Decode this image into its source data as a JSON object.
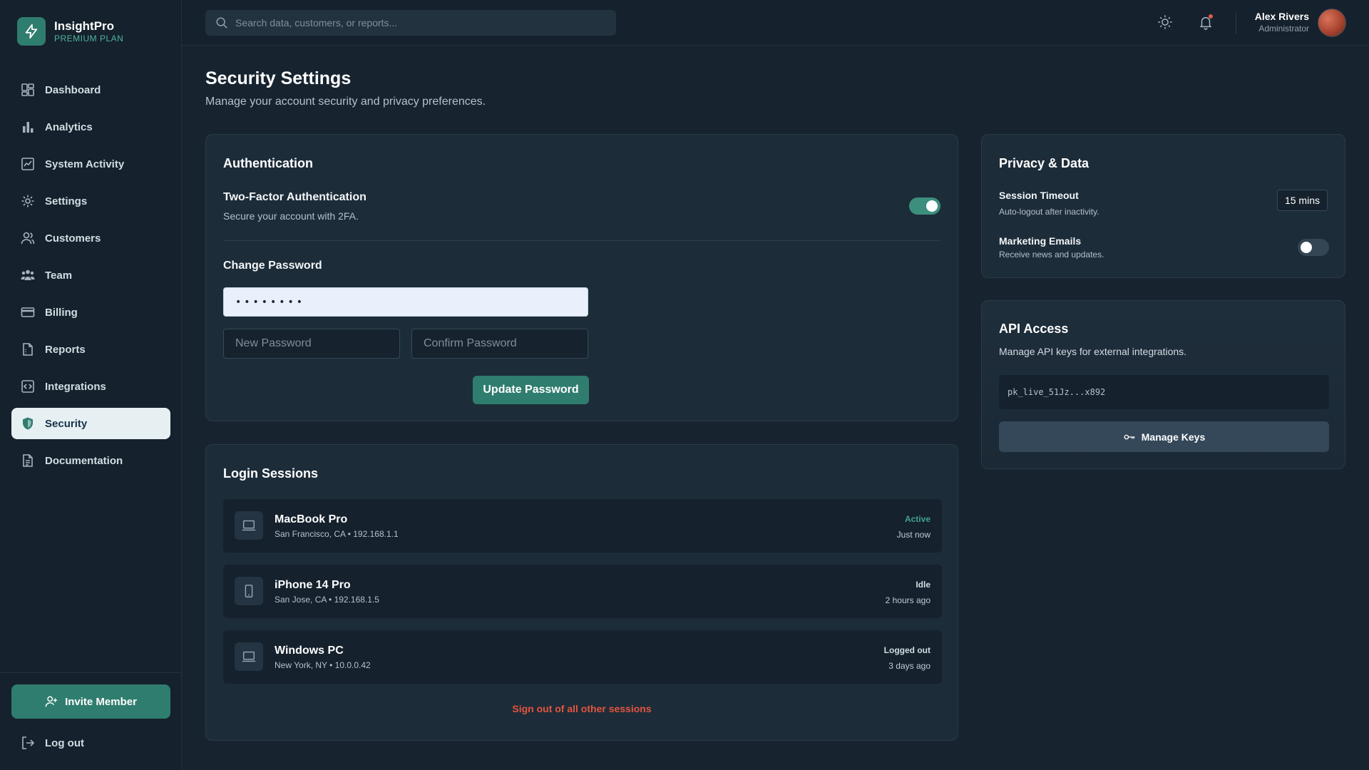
{
  "brand": {
    "name": "InsightPro",
    "plan": "PREMIUM PLAN"
  },
  "sidebar": {
    "items": [
      {
        "label": "Dashboard",
        "icon": "dashboard-icon"
      },
      {
        "label": "Analytics",
        "icon": "bar-chart-icon"
      },
      {
        "label": "System Activity",
        "icon": "activity-chart-icon"
      },
      {
        "label": "Settings",
        "icon": "gear-icon"
      },
      {
        "label": "Customers",
        "icon": "users-icon"
      },
      {
        "label": "Team",
        "icon": "team-icon"
      },
      {
        "label": "Billing",
        "icon": "credit-card-icon"
      },
      {
        "label": "Reports",
        "icon": "report-icon"
      },
      {
        "label": "Integrations",
        "icon": "integration-icon"
      },
      {
        "label": "Security",
        "icon": "shield-icon",
        "active": true
      },
      {
        "label": "Documentation",
        "icon": "document-icon"
      }
    ],
    "invite_label": "Invite Member",
    "logout_label": "Log out"
  },
  "topbar": {
    "search_placeholder": "Search data, customers, or reports...",
    "user_name": "Alex Rivers",
    "user_role": "Administrator"
  },
  "page": {
    "title": "Security Settings",
    "subtitle": "Manage your account security and privacy preferences."
  },
  "authentication": {
    "title": "Authentication",
    "twofa_label": "Two-Factor Authentication",
    "twofa_desc": "Secure your account with 2FA.",
    "twofa_enabled": true,
    "change_password_label": "Change Password",
    "current_password_value": "••••••••",
    "new_password_placeholder": "New Password",
    "confirm_password_placeholder": "Confirm Password",
    "update_button": "Update Password"
  },
  "sessions": {
    "title": "Login Sessions",
    "rows": [
      {
        "device": "MacBook Pro",
        "meta": "San Francisco, CA • 192.168.1.1",
        "status": "Active",
        "time": "Just now",
        "icon": "laptop-icon"
      },
      {
        "device": "iPhone 14 Pro",
        "meta": "San Jose, CA • 192.168.1.5",
        "status": "Idle",
        "time": "2 hours ago",
        "icon": "phone-icon"
      },
      {
        "device": "Windows PC",
        "meta": "New York, NY • 10.0.0.42",
        "status": "Logged out",
        "time": "3 days ago",
        "icon": "laptop-icon"
      }
    ],
    "signout_all": "Sign out of all other sessions"
  },
  "privacy": {
    "title": "Privacy & Data",
    "session_timeout_label": "Session Timeout",
    "session_timeout_desc": "Auto-logout after inactivity.",
    "session_timeout_value": "15 mins",
    "marketing_label": "Marketing Emails",
    "marketing_desc": "Receive news and updates.",
    "marketing_enabled": false
  },
  "api": {
    "title": "API Access",
    "desc": "Manage API keys for external integrations.",
    "key_value": "pk_live_51Jz...x892",
    "manage_button": "Manage Keys"
  },
  "colors": {
    "accent": "#2f7d6e",
    "background": "#172430",
    "card": "#1d2c39",
    "danger": "#e2553f",
    "status_active": "#3fa38d"
  }
}
